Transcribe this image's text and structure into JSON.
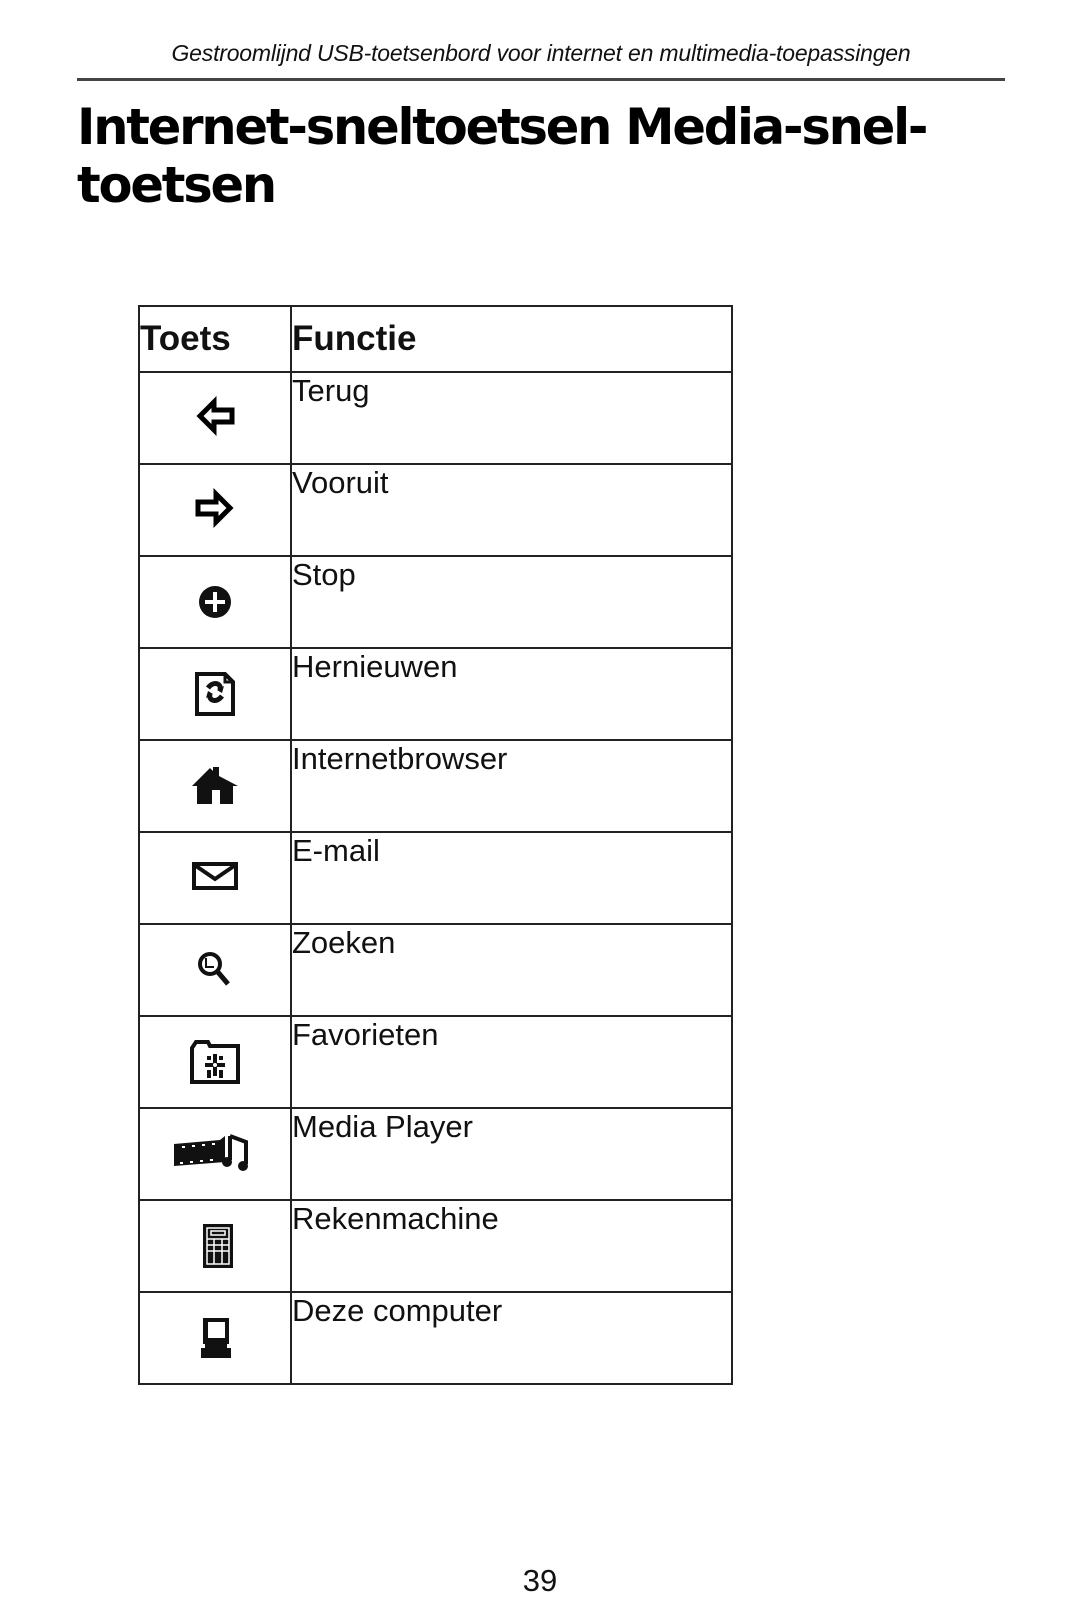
{
  "running_header": "Gestroomlijnd USB-toetsenbord voor internet en multimedia-toepassingen",
  "page_title_line1": "Internet-sneltoetsen Media-snel-",
  "page_title_line2": "toetsen",
  "table": {
    "headers": {
      "key": "Toets",
      "function": "Functie"
    },
    "rows": [
      {
        "icon": "back-arrow-icon",
        "function": "Terug"
      },
      {
        "icon": "forward-arrow-icon",
        "function": "Vooruit"
      },
      {
        "icon": "stop-icon",
        "function": "Stop"
      },
      {
        "icon": "refresh-icon",
        "function": "Hernieuwen"
      },
      {
        "icon": "home-icon",
        "function": "Internetbrowser"
      },
      {
        "icon": "mail-icon",
        "function": "E-mail"
      },
      {
        "icon": "search-icon",
        "function": "Zoeken"
      },
      {
        "icon": "favorites-folder-icon",
        "function": "Favorieten"
      },
      {
        "icon": "media-player-icon",
        "function": "Media Player"
      },
      {
        "icon": "calculator-icon",
        "function": "Rekenmachine"
      },
      {
        "icon": "my-computer-icon",
        "function": "Deze computer"
      }
    ]
  },
  "page_number": "39"
}
